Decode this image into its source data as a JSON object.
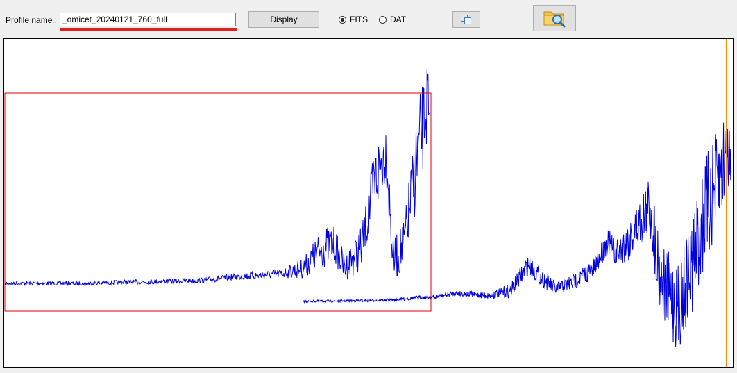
{
  "toolbar": {
    "profile_label": "Profile name :",
    "profile_value": "_omicet_20240121_760_full",
    "display_label": "Display",
    "format_options": [
      {
        "label": "FITS",
        "selected": true
      },
      {
        "label": "DAT",
        "selected": false
      }
    ],
    "copy_icon": "copy-icon",
    "browse_icon": "folder-search-icon"
  },
  "plot": {
    "line_color": "#0000dd",
    "selection_color": "#dd0000",
    "cursor_color": "#ff8c00"
  }
}
